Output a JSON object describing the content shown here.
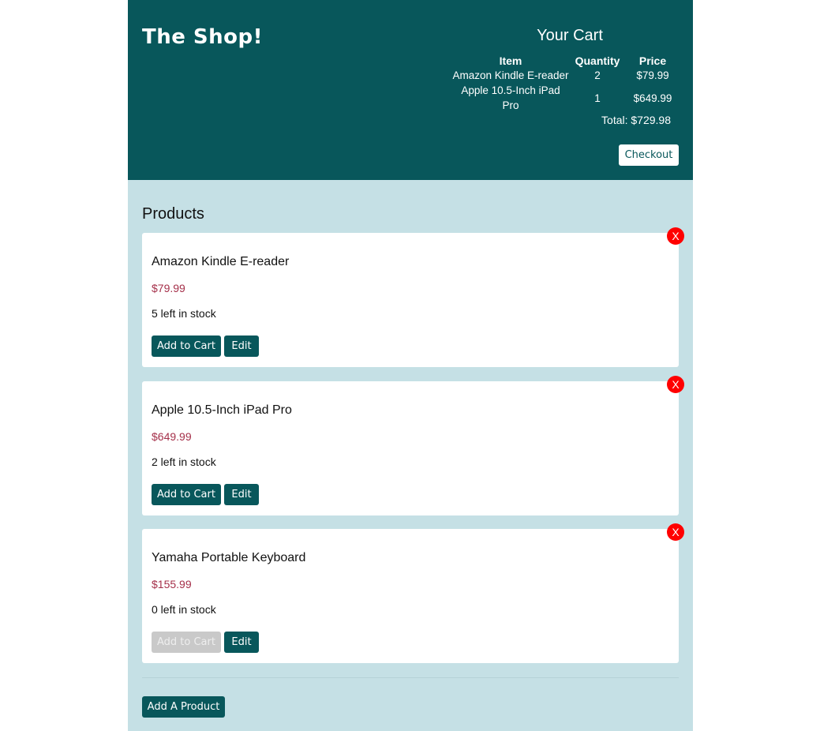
{
  "header": {
    "shop_title": "The Shop!"
  },
  "cart": {
    "title": "Your Cart",
    "columns": {
      "item": "Item",
      "quantity": "Quantity",
      "price": "Price"
    },
    "rows": [
      {
        "item": "Amazon Kindle E-reader",
        "quantity": "2",
        "price": "$79.99"
      },
      {
        "item": "Apple 10.5-Inch iPad Pro",
        "quantity": "1",
        "price": "$649.99"
      }
    ],
    "total": "Total: $729.98",
    "checkout_label": "Checkout"
  },
  "products": {
    "heading": "Products",
    "items": [
      {
        "name": "Amazon Kindle E-reader",
        "price": "$79.99",
        "stock": "5 left in stock",
        "add_label": "Add to Cart",
        "edit_label": "Edit",
        "delete_label": "X",
        "add_disabled": false
      },
      {
        "name": "Apple 10.5-Inch iPad Pro",
        "price": "$649.99",
        "stock": "2 left in stock",
        "add_label": "Add to Cart",
        "edit_label": "Edit",
        "delete_label": "X",
        "add_disabled": false
      },
      {
        "name": "Yamaha Portable Keyboard",
        "price": "$155.99",
        "stock": "0 left in stock",
        "add_label": "Add to Cart",
        "edit_label": "Edit",
        "delete_label": "X",
        "add_disabled": true
      }
    ],
    "add_product_label": "Add A Product"
  },
  "colors": {
    "header_bg": "#08575b",
    "page_bg": "#c5e0e5",
    "price_color": "#a5304a",
    "delete_color": "#ff0000"
  }
}
